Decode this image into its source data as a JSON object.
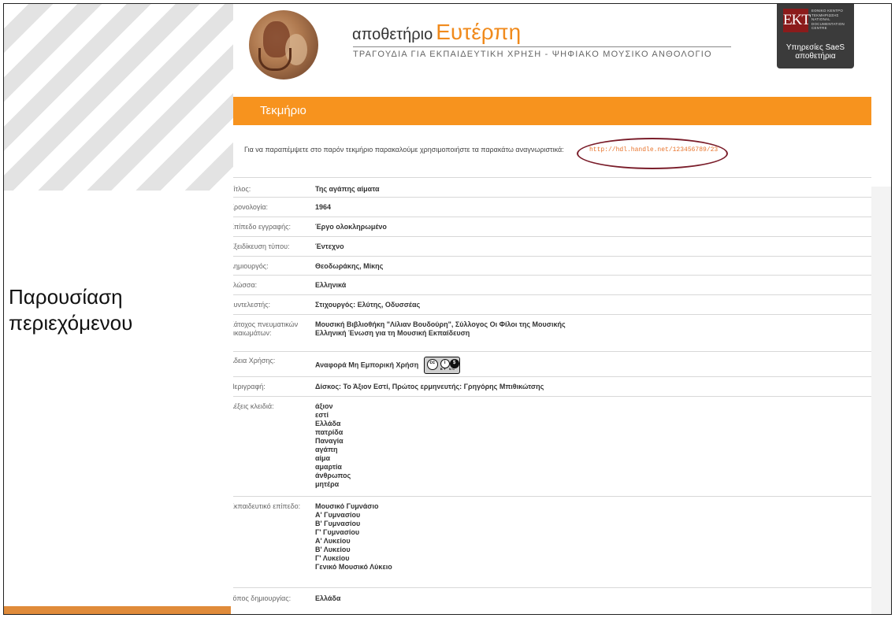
{
  "slide": {
    "heading_line1": "Παρουσίαση",
    "heading_line2": "περιεχόμενου"
  },
  "site": {
    "title_prefix": "αποθετήριο",
    "title_accent": "Ευτέρπη",
    "subtitle": "ΤΡΑΓΟΥΔΙΑ ΓΙΑ ΕΚΠΑΙΔΕΥΤΙΚΗ ΧΡΗΣΗ - ΨΗΦΙΑΚΟ ΜΟΥΣΙΚΟ ΑΝΘΟΛΟΓΙΟ",
    "ekt_logo": "EKT",
    "ekt_small": "ΕΘΝΙΚΟ ΚΕΝΤΡΟ ΤΕΚΜΗΡΙΩΣΗΣ NATIONAL DOCUMENTATION CENTRE",
    "ekt_services": "Υπηρεσίες SaeS",
    "ekt_services_2": "αποθετήρια"
  },
  "section": {
    "title": "Τεκμήριο"
  },
  "citation": {
    "text": "Για να παραπέμψετε στο παρόν τεκμήριο παρακαλούμε χρησιμοποιήστε τα παρακάτω αναγνωριστικά:",
    "link": "http://hdl.handle.net/123456789/23"
  },
  "metadata": {
    "title_label": "Τίτλος:",
    "title_value": "Της αγάπης αίματα",
    "year_label": "Χρονολογία:",
    "year_value": "1964",
    "level_label": "Επίπεδο εγγραφής:",
    "level_value": "Έργο ολοκληρωμένο",
    "type_label": "Εξειδίκευση τύπου:",
    "type_value": "Έντεχνο",
    "creator_label": "Δημιουργός:",
    "creator_value": "Θεοδωράκης, Μίκης",
    "lang_label": "Γλώσσα:",
    "lang_value": "Ελληνικά",
    "contrib_label": "Συντελεστής:",
    "contrib_value": "Στιχουργός: Ελύτης, Οδυσσέας",
    "rights_label_1": "Κάτοχος",
    "rights_label_2": "πνευματικών",
    "rights_label_3": "δικαιωμάτων:",
    "rights_value_1": "Μουσική Βιβλιοθήκη \"Λίλιαν Βουδούρη\", Σύλλογος Οι Φίλοι της Μουσικής",
    "rights_value_2": "Ελληνική Ένωση για τη Μουσική Εκπαίδευση",
    "license_label": "Άδεια Χρήσης:",
    "license_value": "Αναφορά Μη Εμπορική Χρήση",
    "cc_tag": "BY NC",
    "desc_label": "Περιγραφή:",
    "desc_value": "Δίσκος: Το Άξιον Εστί, Πρώτος ερμηνευτής: Γρηγόρης Μπιθικώτσης",
    "keywords_label": "Λέξεις κλειδιά:",
    "keywords": [
      "άξιον",
      "εστί",
      "Ελλάδα",
      "πατρίδα",
      "Παναγία",
      "αγάπη",
      "αίμα",
      "αμαρτία",
      "άνθρωπος",
      "μητέρα"
    ],
    "edu_label_1": "Εκπαιδευτικό",
    "edu_label_2": "επίπεδο:",
    "edu_levels": [
      "Μουσικό Γυμνάσιο",
      "Α' Γυμνασίου",
      "Β' Γυμνασίου",
      "Γ' Γυμνασίου",
      "Α' Λυκείου",
      "Β' Λυκείου",
      "Γ' Λυκείου",
      "Γενικό Μουσικό Λύκειο"
    ],
    "place_label": "Τόπος δημιουργίας:",
    "place_value": "Ελλάδα"
  },
  "colors": {
    "orange": "#f7931e",
    "accent": "#f08a1c",
    "ellipse": "#7a1d2a"
  }
}
